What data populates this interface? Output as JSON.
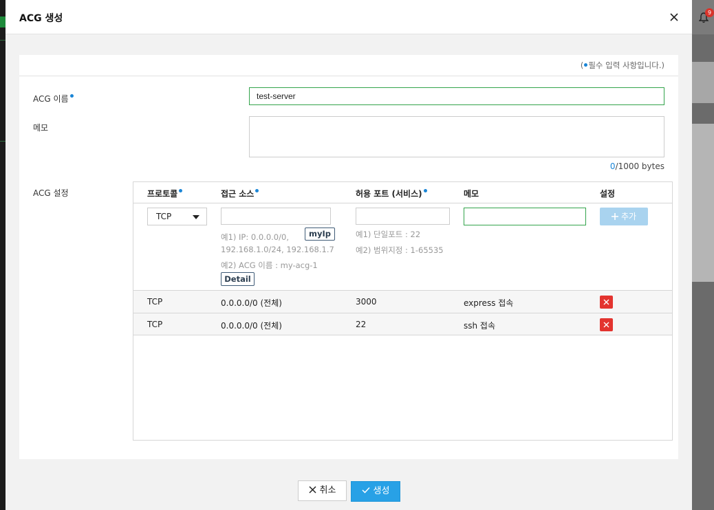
{
  "modal": {
    "title": "ACG 생성",
    "required_note_prefix": "(",
    "required_note_suffix": "필수 입력 사항입니다.)"
  },
  "form": {
    "acg_name_label": "ACG 이름",
    "acg_name_value": "test-server",
    "memo_label": "메모",
    "memo_value": "",
    "byte_count": "0",
    "byte_limit": "/1000 bytes",
    "acg_settings_label": "ACG 설정"
  },
  "rules_table": {
    "headers": {
      "protocol": "프로토콜",
      "source": "접근 소스",
      "port": "허용 포트 (서비스)",
      "memo": "메모",
      "settings": "설정"
    },
    "new_rule": {
      "protocol_selected": "TCP",
      "source_value": "",
      "port_value": "",
      "memo_value": "",
      "myip_button": "myIp",
      "source_hint_1": "예1) IP: 0.0.0.0/0,",
      "source_hint_2": "192.168.1.0/24, 192.168.1.7",
      "source_hint_3": "예2) ACG 이름 : my-acg-1",
      "detail_button": "Detail",
      "port_hint_1": "예1) 단일포트 : 22",
      "port_hint_2": "예2) 범위지정 : 1-65535",
      "add_button": "추가"
    },
    "rows": [
      {
        "protocol": "TCP",
        "source": "0.0.0.0/0 (전체)",
        "port": "3000",
        "memo": "express 접속"
      },
      {
        "protocol": "TCP",
        "source": "0.0.0.0/0 (전체)",
        "port": "22",
        "memo": "ssh 접속"
      }
    ]
  },
  "footer": {
    "cancel_label": "취소",
    "create_label": "생성"
  },
  "background": {
    "notification_count": "9"
  },
  "colors": {
    "accent": "#28a1e6",
    "required_dot": "#1a85d6",
    "delete": "#e3342f",
    "focus_border": "#31a34a"
  }
}
